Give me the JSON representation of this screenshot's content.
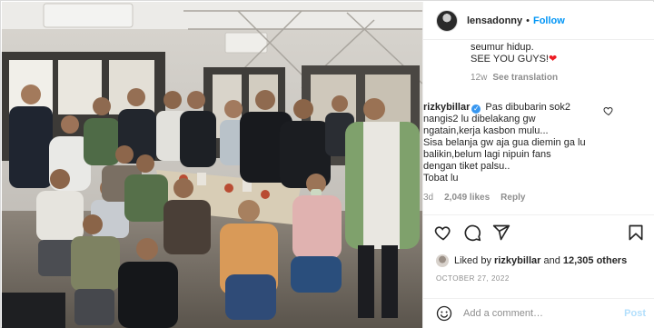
{
  "header": {
    "username": "lensadonny",
    "separator": "•",
    "follow_label": "Follow"
  },
  "caption": {
    "lines": [
      "seumur hidup.",
      "SEE YOU GUYS!"
    ],
    "emoji": "❤",
    "age": "12w",
    "translation_label": "See translation"
  },
  "comment": {
    "username": "rizkybillar",
    "verified_glyph": "✓",
    "lines": [
      "Pas dibubarin sok2",
      "nangis2 lu dibelakang gw",
      "ngatain,kerja kasbon mulu...",
      "Sisa belanja gw aja gua diemin ga lu",
      "balikin,belum lagi nipuin fans",
      "dengan tiket palsu..",
      "Tobat lu"
    ],
    "age": "3d",
    "likes": "2,049 likes",
    "reply_label": "Reply"
  },
  "actions": {
    "icons": [
      "heart-icon",
      "comment-icon",
      "share-icon",
      "bookmark-icon"
    ]
  },
  "likes_summary": {
    "prefix": "Liked by",
    "user": "rizkybillar",
    "middle": "and",
    "others": "12,305 others"
  },
  "date": "OCTOBER 27, 2022",
  "add_comment": {
    "placeholder": "Add a comment…",
    "post_label": "Post"
  },
  "colors": {
    "accent": "#0095f6",
    "verified": "#3897f0",
    "muted": "#8e8e8e",
    "post_disabled": "#b2dffc"
  }
}
